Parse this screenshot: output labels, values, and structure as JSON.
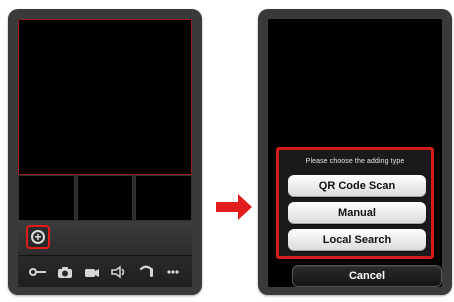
{
  "left_screen": {
    "toolbar": {
      "icons": [
        "key-icon",
        "camera-icon",
        "video-icon",
        "speaker-icon",
        "phone-icon",
        "more-icon"
      ]
    },
    "add_button_icon": "plus-circle-icon",
    "highlight_color": "#e21b1b"
  },
  "right_screen": {
    "dialog": {
      "title": "Please choose the adding type",
      "options": [
        {
          "label": "QR Code Scan"
        },
        {
          "label": "Manual"
        },
        {
          "label": "Local Search"
        }
      ],
      "cancel_label": "Cancel"
    },
    "highlight_color": "#d61b1b"
  },
  "arrow_color": "#e11d1d"
}
